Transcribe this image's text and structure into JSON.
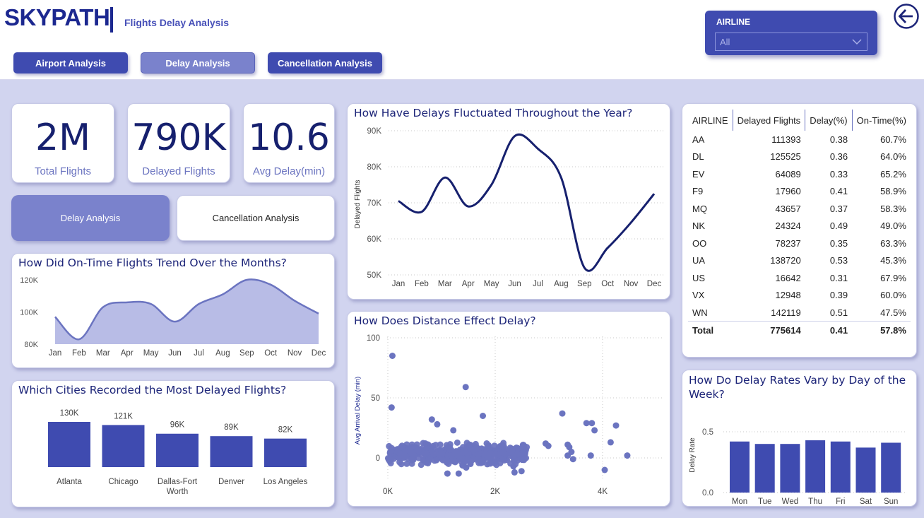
{
  "header": {
    "brand": "SKYPATH",
    "subtitle": "Flights Delay Analysis",
    "nav": [
      {
        "label": "Airport Analysis"
      },
      {
        "label": "Delay Analysis"
      },
      {
        "label": "Cancellation Analysis"
      }
    ],
    "slicer": {
      "label": "AIRLINE",
      "value": "All"
    }
  },
  "kpis": [
    {
      "value": "2M",
      "label": "Total Flights"
    },
    {
      "value": "790K",
      "label": "Delayed Flights"
    },
    {
      "value": "10.6",
      "label": "Avg Delay(min)"
    }
  ],
  "tabs": {
    "delay": "Delay Analysis",
    "cancel": "Cancellation Analysis"
  },
  "colors": {
    "brand": "#1c2890",
    "accent": "#3f4bb0",
    "light_accent": "#7a82cc",
    "background": "#d1d4ef"
  },
  "chart_data": [
    {
      "id": "ontime",
      "type": "area",
      "title": "How Did On-Time Flights Trend Over the Months?",
      "categories": [
        "Jan",
        "Feb",
        "Mar",
        "Apr",
        "May",
        "Jun",
        "Jul",
        "Aug",
        "Sep",
        "Oct",
        "Nov",
        "Dec"
      ],
      "values": [
        97000,
        83000,
        103000,
        106000,
        105000,
        94000,
        105000,
        111000,
        120000,
        117000,
        107000,
        99000
      ],
      "ylim": [
        80000,
        120000
      ],
      "yticks": [
        "80K",
        "100K",
        "120K"
      ],
      "yticks_values": [
        80000,
        100000,
        120000
      ]
    },
    {
      "id": "delays",
      "type": "line",
      "title": "How Have Delays Fluctuated Throughout the Year?",
      "ylabel": "Delayed Flights",
      "categories": [
        "Jan",
        "Feb",
        "Mar",
        "Apr",
        "May",
        "Jun",
        "Jul",
        "Aug",
        "Sep",
        "Oct",
        "Nov",
        "Dec"
      ],
      "values": [
        70500,
        67500,
        77000,
        69000,
        75000,
        88500,
        85000,
        77000,
        52000,
        57500,
        64500,
        72500
      ],
      "ylim": [
        50000,
        90000
      ],
      "yticks": [
        "50K",
        "60K",
        "70K",
        "80K",
        "90K"
      ],
      "yticks_values": [
        50000,
        60000,
        70000,
        80000,
        90000
      ]
    },
    {
      "id": "cities",
      "type": "bar",
      "title": "Which Cities Recorded the Most Delayed Flights?",
      "categories": [
        "Atlanta",
        "Chicago",
        "Dallas-Fort Worth",
        "Denver",
        "Los Angeles"
      ],
      "category_lines": [
        [
          "Atlanta"
        ],
        [
          "Chicago"
        ],
        [
          "Dallas-Fort",
          "Worth"
        ],
        [
          "Denver"
        ],
        [
          "Los Angeles"
        ]
      ],
      "values": [
        130000,
        121000,
        96000,
        89000,
        82000
      ],
      "data_labels": [
        "130K",
        "121K",
        "96K",
        "89K",
        "82K"
      ]
    },
    {
      "id": "distance",
      "type": "scatter",
      "title": "How Does Distance Effect Delay?",
      "ylabel": "Avg Arrival Delay (min)",
      "xticks": [
        "0K",
        "2K",
        "4K"
      ],
      "xticks_values": [
        0,
        2000,
        4000
      ],
      "yticks": [
        "0",
        "50",
        "100"
      ],
      "yticks_values": [
        0,
        50,
        100
      ],
      "xlim": [
        0,
        4600
      ],
      "ylim": [
        -10,
        100
      ],
      "outliers": [
        [
          85,
          85
        ],
        [
          70,
          42
        ],
        [
          1450,
          59
        ],
        [
          1770,
          35
        ],
        [
          3250,
          37
        ],
        [
          3700,
          29
        ],
        [
          3800,
          29
        ],
        [
          3850,
          23
        ],
        [
          4250,
          27
        ],
        [
          3350,
          11
        ],
        [
          3380,
          9
        ],
        [
          4150,
          13
        ],
        [
          3350,
          2
        ],
        [
          3420,
          5
        ],
        [
          3450,
          -1
        ],
        [
          4460,
          2
        ],
        [
          4040,
          -10
        ],
        [
          3780,
          2
        ],
        [
          1400,
          -6
        ],
        [
          1540,
          -5
        ],
        [
          1460,
          -8
        ],
        [
          1110,
          -13
        ],
        [
          1320,
          -13
        ],
        [
          2340,
          -7
        ],
        [
          2490,
          -11
        ],
        [
          2360,
          -12
        ],
        [
          1520,
          11
        ],
        [
          2990,
          10
        ],
        [
          820,
          32
        ],
        [
          920,
          28
        ],
        [
          1220,
          23
        ],
        [
          2940,
          12
        ],
        [
          2140,
          9
        ]
      ],
      "cluster": {
        "x_range": [
          0,
          2600
        ],
        "y_range": [
          -8,
          15
        ],
        "n": 500
      }
    },
    {
      "id": "weekday",
      "type": "bar",
      "title": "How Do Delay Rates Vary by Day of the Week?",
      "title_lines": [
        "How Do Delay Rates Vary by Day of the",
        "Week?"
      ],
      "ylabel": "Delay Rate",
      "categories": [
        "Mon",
        "Tue",
        "Wed",
        "Thu",
        "Fri",
        "Sat",
        "Sun"
      ],
      "values": [
        0.42,
        0.4,
        0.4,
        0.43,
        0.42,
        0.37,
        0.41
      ],
      "ylim": [
        0,
        0.5
      ],
      "yticks": [
        "0.0",
        "0.5"
      ],
      "yticks_values": [
        0,
        0.5
      ]
    },
    {
      "id": "airline_table",
      "type": "table",
      "columns": [
        "AIRLINE",
        "Delayed Flights",
        "Delay(%)",
        "On-Time(%)"
      ],
      "rows": [
        [
          "AA",
          "111393",
          "0.38",
          "60.7%"
        ],
        [
          "DL",
          "125525",
          "0.36",
          "64.0%"
        ],
        [
          "EV",
          "64089",
          "0.33",
          "65.2%"
        ],
        [
          "F9",
          "17960",
          "0.41",
          "58.9%"
        ],
        [
          "MQ",
          "43657",
          "0.37",
          "58.3%"
        ],
        [
          "NK",
          "24324",
          "0.49",
          "49.0%"
        ],
        [
          "OO",
          "78237",
          "0.35",
          "63.3%"
        ],
        [
          "UA",
          "138720",
          "0.53",
          "45.3%"
        ],
        [
          "US",
          "16642",
          "0.31",
          "67.9%"
        ],
        [
          "VX",
          "12948",
          "0.39",
          "60.0%"
        ],
        [
          "WN",
          "142119",
          "0.51",
          "47.5%"
        ]
      ],
      "total": [
        "Total",
        "775614",
        "0.41",
        "57.8%"
      ]
    }
  ]
}
